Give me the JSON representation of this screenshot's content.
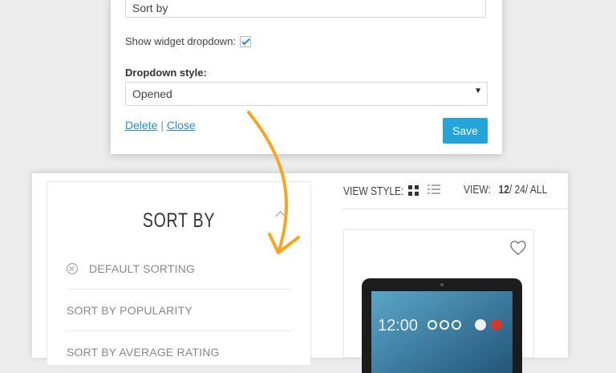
{
  "widget": {
    "title_value": "Sort by",
    "show_dropdown_label": "Show widget dropdown:",
    "show_dropdown_checked": true,
    "dropdown_style_label": "Dropdown style:",
    "dropdown_style_value": "Opened",
    "delete_link": "Delete",
    "links_separator": "|",
    "close_link": "Close",
    "save_label": "Save"
  },
  "shop": {
    "sort_title": "SORT BY",
    "sort_items": [
      {
        "label": "DEFAULT SORTING",
        "active": true
      },
      {
        "label": "SORT BY POPULARITY",
        "active": false
      },
      {
        "label": "SORT BY AVERAGE RATING",
        "active": false
      }
    ],
    "view_style_label": "VIEW STYLE:",
    "view_label": "VIEW:",
    "view_options": [
      "12",
      "/ 24",
      "/ ALL"
    ],
    "product_screen_time": "12:00"
  },
  "colors": {
    "accent": "#24a4d8",
    "link": "#2e8bc9",
    "arrow": "#f5a623"
  },
  "icons": [
    "checkbox-checked",
    "select-caret-icon",
    "chevron-up-icon",
    "remove-icon",
    "grid-view-icon",
    "list-view-icon",
    "heart-icon"
  ]
}
